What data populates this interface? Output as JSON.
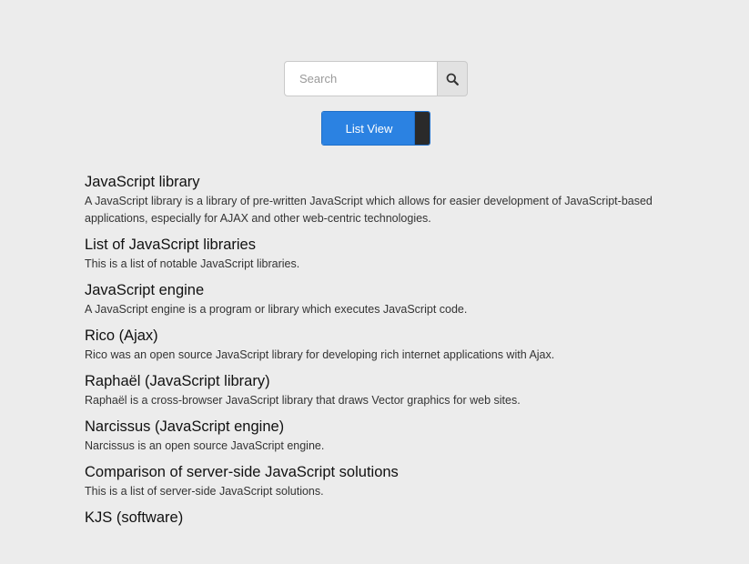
{
  "search": {
    "placeholder": "Search",
    "value": "",
    "button_icon": "search-icon"
  },
  "view_toggle": {
    "label": "List View"
  },
  "results": [
    {
      "title": "JavaScript library",
      "description": "A JavaScript library is a library of pre-written JavaScript which allows for easier development of JavaScript-based applications, especially for AJAX and other web-centric technologies."
    },
    {
      "title": "List of JavaScript libraries",
      "description": "This is a list of notable JavaScript libraries."
    },
    {
      "title": "JavaScript engine",
      "description": "A JavaScript engine is a program or library which executes JavaScript code."
    },
    {
      "title": "Rico (Ajax)",
      "description": "Rico was an open source JavaScript library for developing rich internet applications with Ajax."
    },
    {
      "title": "Raphaël (JavaScript library)",
      "description": "Raphaël is a cross-browser JavaScript library that draws Vector graphics for web sites."
    },
    {
      "title": "Narcissus (JavaScript engine)",
      "description": "Narcissus is an open source JavaScript engine."
    },
    {
      "title": "Comparison of server-side JavaScript solutions",
      "description": "This is a list of server-side JavaScript solutions."
    },
    {
      "title": "KJS (software)",
      "description": ""
    }
  ]
}
